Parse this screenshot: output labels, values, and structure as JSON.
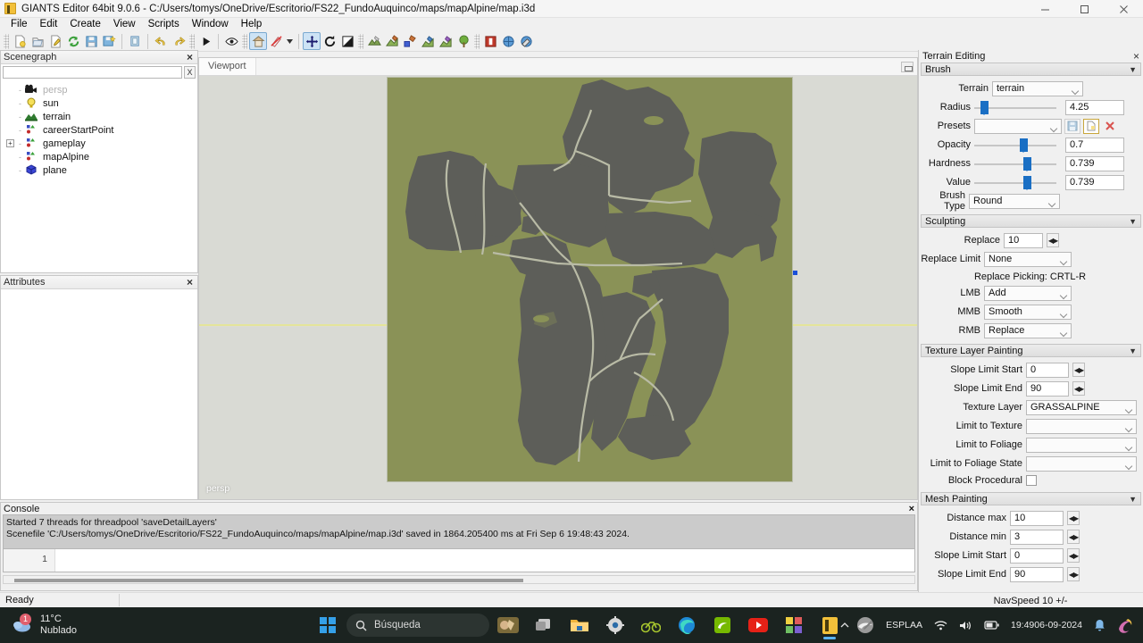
{
  "window": {
    "title": "GIANTS Editor 64bit 9.0.6 - C:/Users/tomys/OneDrive/Escritorio/FS22_FundoAuquinco/maps/mapAlpine/map.i3d",
    "app_icon": "giants-editor-icon",
    "minimize": "minimize-icon",
    "maximize": "maximize-icon",
    "close": "close-icon"
  },
  "menu": {
    "items": [
      "File",
      "Edit",
      "Create",
      "View",
      "Scripts",
      "Window",
      "Help"
    ]
  },
  "toolbar": {
    "groups": [
      {
        "buttons": [
          {
            "name": "new-file-icon",
            "active": false
          },
          {
            "name": "open-file-icon",
            "active": false
          },
          {
            "name": "edit-file-icon",
            "active": false
          },
          {
            "name": "reload-icon",
            "active": false
          },
          {
            "name": "save-icon",
            "active": false
          },
          {
            "name": "save-as-icon",
            "active": false
          }
        ]
      },
      {
        "buttons": [
          {
            "name": "copy-paste-icon",
            "active": false
          }
        ]
      },
      {
        "buttons": [
          {
            "name": "undo-icon",
            "active": false
          },
          {
            "name": "redo-icon",
            "active": false
          }
        ]
      },
      {
        "buttons": [
          {
            "name": "play-icon",
            "active": false
          }
        ]
      },
      {
        "buttons": [
          {
            "name": "eye-visibility-icon",
            "active": false
          }
        ]
      },
      {
        "buttons": [
          {
            "name": "home-view-icon",
            "active": true
          },
          {
            "name": "no-render-icon",
            "active": false
          },
          {
            "name": "chevron-down-icon",
            "active": false
          }
        ]
      },
      {
        "buttons": [
          {
            "name": "translate-tool-icon",
            "active": true
          },
          {
            "name": "rotate-tool-icon",
            "active": false
          },
          {
            "name": "scale-tool-icon",
            "active": false
          }
        ]
      },
      {
        "buttons": [
          {
            "name": "terrain-sculpt-icon",
            "active": false
          },
          {
            "name": "terrain-paint-icon",
            "active": false
          },
          {
            "name": "foliage-paint-icon",
            "active": false
          },
          {
            "name": "texture-paint-icon",
            "active": false
          },
          {
            "name": "mesh-paint-icon",
            "active": false
          },
          {
            "name": "tree-paint-icon",
            "active": false
          }
        ]
      },
      {
        "buttons": [
          {
            "name": "terrain-info-icon",
            "active": false
          },
          {
            "name": "navmesh-icon",
            "active": false
          },
          {
            "name": "navmesh-edit-icon",
            "active": false
          }
        ]
      }
    ]
  },
  "scenegraph": {
    "title": "Scenegraph",
    "close_label": "×",
    "search_value": "",
    "search_placeholder": "",
    "clear_label": "X",
    "items": [
      {
        "label": "persp",
        "icon": "camera-icon",
        "dim": true,
        "expandable": false,
        "indent": 0
      },
      {
        "label": "sun",
        "icon": "light-bulb-icon",
        "dim": false,
        "expandable": false,
        "indent": 0
      },
      {
        "label": "terrain",
        "icon": "terrain-icon",
        "dim": false,
        "expandable": false,
        "indent": 0
      },
      {
        "label": "careerStartPoint",
        "icon": "transform-group-icon",
        "dim": false,
        "expandable": false,
        "indent": 0
      },
      {
        "label": "gameplay",
        "icon": "transform-group-icon",
        "dim": false,
        "expandable": true,
        "indent": 0
      },
      {
        "label": "mapAlpine",
        "icon": "transform-group-icon",
        "dim": false,
        "expandable": false,
        "indent": 0
      },
      {
        "label": "plane",
        "icon": "mesh-cube-icon",
        "dim": false,
        "expandable": false,
        "indent": 0
      }
    ]
  },
  "attributes": {
    "title": "Attributes",
    "close_label": "×"
  },
  "viewport": {
    "tab_label": "Viewport",
    "camera_label": "persp",
    "ground_color": "#8a9257",
    "painted_color": "#5e5f5a",
    "road_color": "#bfc0b2",
    "background_top": "#d9dad4",
    "selection_color": "#1a4fd8"
  },
  "console": {
    "title": "Console",
    "close_label": "×",
    "lines": [
      "Started 7 threads for threadpool 'saveDetailLayers'",
      "Scenefile 'C:/Users/tomys/OneDrive/Escritorio/FS22_FundoAuquinco/maps/mapAlpine/map.i3d' saved in 1864.205400 ms at Fri Sep  6 19:48:43 2024."
    ],
    "input_line_number": "1",
    "input_value": ""
  },
  "statusbar": {
    "status": "Ready",
    "nav_speed": "NavSpeed 10 +/-"
  },
  "terrain_editing": {
    "title": "Terrain Editing",
    "close_label": "×",
    "brush": {
      "title": "Brush",
      "terrain_label": "Terrain",
      "terrain_value": "terrain",
      "radius_label": "Radius",
      "radius_value": "4.25",
      "radius_pct": 8,
      "presets_label": "Presets",
      "presets_value": "",
      "presets_buttons": [
        "save-preset-icon",
        "new-preset-icon",
        "delete-preset-icon"
      ],
      "opacity_label": "Opacity",
      "opacity_value": "0.7",
      "opacity_pct": 62,
      "hardness_label": "Hardness",
      "hardness_value": "0.739",
      "hardness_pct": 66,
      "value_label": "Value",
      "value_value": "0.739",
      "value_pct": 66,
      "brush_type_label": "Brush Type",
      "brush_type_value": "Round"
    },
    "sculpting": {
      "title": "Sculpting",
      "replace_label": "Replace",
      "replace_value": "10",
      "replace_limit_label": "Replace Limit",
      "replace_limit_value": "None",
      "hint": "Replace Picking: CRTL-R",
      "lmb_label": "LMB",
      "lmb_value": "Add",
      "mmb_label": "MMB",
      "mmb_value": "Smooth",
      "rmb_label": "RMB",
      "rmb_value": "Replace"
    },
    "texture_layer_painting": {
      "title": "Texture Layer Painting",
      "slope_limit_start_label": "Slope Limit Start",
      "slope_limit_start_value": "0",
      "slope_limit_end_label": "Slope Limit End",
      "slope_limit_end_value": "90",
      "texture_layer_label": "Texture Layer",
      "texture_layer_value": "GRASSALPINE",
      "limit_to_texture_label": "Limit to Texture",
      "limit_to_texture_value": "",
      "limit_to_foliage_label": "Limit to Foliage",
      "limit_to_foliage_value": "",
      "limit_to_foliage_state_label": "Limit to Foliage State",
      "limit_to_foliage_state_value": "",
      "block_procedural_label": "Block Procedural",
      "block_procedural_checked": false
    },
    "mesh_painting": {
      "title": "Mesh Painting",
      "distance_max_label": "Distance max",
      "distance_max_value": "10",
      "distance_min_label": "Distance min",
      "distance_min_value": "3",
      "slope_limit_start_label": "Slope Limit Start",
      "slope_limit_start_value": "0",
      "slope_limit_end_label": "Slope Limit End",
      "slope_limit_end_value": "90"
    }
  },
  "taskbar": {
    "weather_temp": "11°C",
    "weather_desc": "Nublado",
    "weather_badge": "1",
    "start_label": "start-windows-icon",
    "search_placeholder": "Búsqueda",
    "icons": [
      "widgets-icon",
      "task-view-icon",
      "file-explorer-icon",
      "settings-icon",
      "cycling-app-icon",
      "edge-icon",
      "nvidia-icon",
      "youtube-icon",
      "winrar-icon",
      "giants-editor-icon",
      "blender-icon"
    ],
    "tray_expand": "show-hidden-icons-icon",
    "tray_pen": "pen-icon",
    "lang_line1": "ESP",
    "lang_line2": "LAA",
    "wifi": "wifi-icon",
    "volume": "volume-icon",
    "battery": "battery-icon",
    "time": "19:49",
    "date": "06-09-2024",
    "notifications": "notification-bell-icon",
    "copilot": "copilot-icon"
  }
}
